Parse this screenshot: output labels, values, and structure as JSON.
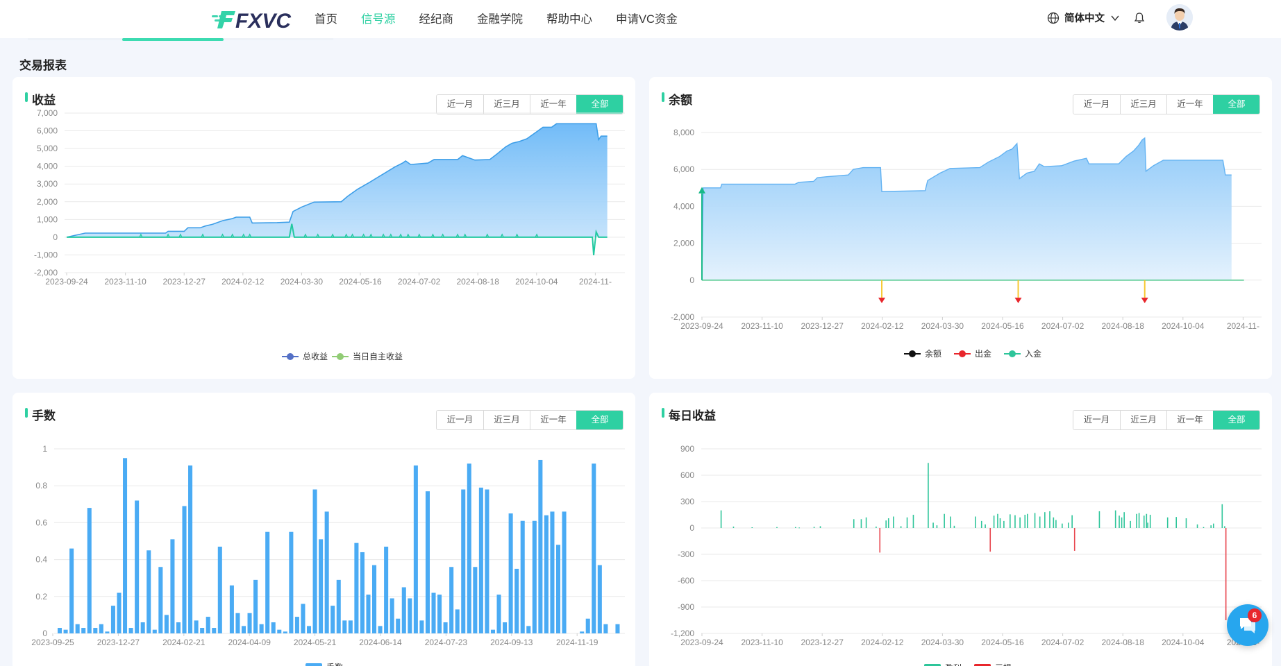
{
  "header": {
    "logo_text": "FXVC",
    "nav": [
      "首页",
      "信号源",
      "经纪商",
      "金融学院",
      "帮助中心",
      "申请VC资金"
    ],
    "language": "简体中文"
  },
  "page": {
    "section_title": "交易报表"
  },
  "range_options": [
    "近一月",
    "近三月",
    "近一年",
    "全部"
  ],
  "colors": {
    "accent": "#2ed0a2",
    "area_blue": "#5ab0f5",
    "bar_blue": "#4aabf4",
    "profit": "#2ec59a",
    "loss": "#e8464e",
    "deposit": "#19b989",
    "withdraw_marker": "#f7c934"
  },
  "chat": {
    "badge": "6"
  },
  "chart_data": [
    {
      "type": "area",
      "title": "收益",
      "x_ticks": [
        "2023-09-24",
        "2023-11-10",
        "2023-12-27",
        "2024-02-12",
        "2024-03-30",
        "2024-05-16",
        "2024-07-02",
        "2024-08-18",
        "2024-10-04",
        "2024-11-"
      ],
      "y_ticks": [
        "7,000",
        "6,000",
        "5,000",
        "4,000",
        "3,000",
        "2,000",
        "1,000",
        "0",
        "-1,000",
        "-2,000"
      ],
      "ylim": [
        -2000,
        7000
      ],
      "x_range_days": [
        0,
        440
      ],
      "grid": true,
      "legend": [
        "总收益",
        "当日自主收益"
      ],
      "legend_colors": [
        "#5470c6",
        "#91cc75"
      ],
      "series": [
        {
          "name": "总收益",
          "points": [
            [
              0,
              0
            ],
            [
              15,
              230
            ],
            [
              80,
              230
            ],
            [
              82,
              330
            ],
            [
              95,
              330
            ],
            [
              98,
              530
            ],
            [
              108,
              530
            ],
            [
              112,
              630
            ],
            [
              118,
              730
            ],
            [
              126,
              930
            ],
            [
              134,
              1050
            ],
            [
              137,
              1130
            ],
            [
              148,
              1130
            ],
            [
              150,
              800
            ],
            [
              170,
              820
            ],
            [
              180,
              850
            ],
            [
              183,
              1450
            ],
            [
              190,
              1700
            ],
            [
              200,
              1980
            ],
            [
              222,
              2000
            ],
            [
              227,
              2300
            ],
            [
              235,
              2700
            ],
            [
              240,
              2900
            ],
            [
              245,
              3100
            ],
            [
              252,
              3400
            ],
            [
              258,
              3650
            ],
            [
              265,
              3950
            ],
            [
              272,
              4200
            ],
            [
              274,
              4300
            ],
            [
              278,
              4100
            ],
            [
              292,
              4180
            ],
            [
              297,
              4380
            ],
            [
              316,
              4380
            ],
            [
              320,
              4600
            ],
            [
              330,
              4350
            ],
            [
              342,
              4380
            ],
            [
              348,
              4700
            ],
            [
              355,
              5100
            ],
            [
              360,
              5300
            ],
            [
              366,
              5400
            ],
            [
              372,
              5550
            ],
            [
              378,
              5850
            ],
            [
              385,
              6200
            ],
            [
              392,
              6200
            ],
            [
              396,
              6400
            ],
            [
              428,
              6400
            ],
            [
              430,
              5500
            ],
            [
              432,
              5700
            ],
            [
              437,
              5700
            ]
          ]
        },
        {
          "name": "当日自主收益",
          "points": [
            [
              0,
              0
            ],
            [
              180,
              0
            ],
            [
              182,
              750
            ],
            [
              184,
              0
            ],
            [
              425,
              0
            ],
            [
              426,
              -1020
            ],
            [
              428,
              300
            ],
            [
              430,
              0
            ],
            [
              437,
              0
            ]
          ],
          "spikes_minor": [
            60,
            82,
            92,
            110,
            126,
            134,
            143,
            148,
            193,
            203,
            215,
            226,
            231,
            240,
            246,
            256,
            262,
            270,
            276,
            285,
            296,
            304,
            316,
            322,
            340,
            352,
            364,
            380
          ]
        }
      ]
    },
    {
      "type": "area",
      "title": "余额",
      "x_ticks": [
        "2023-09-24",
        "2023-11-10",
        "2023-12-27",
        "2024-02-12",
        "2024-03-30",
        "2024-05-16",
        "2024-07-02",
        "2024-08-18",
        "2024-10-04",
        "2024-11-"
      ],
      "y_ticks": [
        "8,000",
        "6,000",
        "4,000",
        "2,000",
        "0",
        "-2,000"
      ],
      "ylim": [
        -2000,
        8000
      ],
      "x_range_days": [
        0,
        440
      ],
      "grid": true,
      "legend": [
        "余额",
        "出金",
        "入金"
      ],
      "legend_colors": [
        "#111111",
        "#e8262c",
        "#2ec59a"
      ],
      "series": [
        {
          "name": "余额",
          "points": [
            [
              0,
              0
            ],
            [
              1,
              5000
            ],
            [
              15,
              5000
            ],
            [
              16,
              5200
            ],
            [
              75,
              5200
            ],
            [
              78,
              5300
            ],
            [
              90,
              5350
            ],
            [
              93,
              5550
            ],
            [
              100,
              5600
            ],
            [
              118,
              5700
            ],
            [
              122,
              6000
            ],
            [
              130,
              6100
            ],
            [
              144,
              6100
            ],
            [
              145,
              4800
            ],
            [
              180,
              4850
            ],
            [
              182,
              5400
            ],
            [
              192,
              5800
            ],
            [
              200,
              6050
            ],
            [
              224,
              6100
            ],
            [
              231,
              6400
            ],
            [
              240,
              6700
            ],
            [
              246,
              7000
            ],
            [
              250,
              7100
            ],
            [
              254,
              7400
            ],
            [
              256,
              5500
            ],
            [
              262,
              5800
            ],
            [
              268,
              5900
            ],
            [
              272,
              6300
            ],
            [
              276,
              6150
            ],
            [
              290,
              6200
            ],
            [
              300,
              6450
            ],
            [
              310,
              6600
            ],
            [
              312,
              6300
            ],
            [
              336,
              6300
            ],
            [
              342,
              6700
            ],
            [
              348,
              7000
            ],
            [
              352,
              7300
            ],
            [
              355,
              7600
            ],
            [
              357,
              7700
            ],
            [
              358,
              5900
            ],
            [
              364,
              6200
            ],
            [
              372,
              6500
            ],
            [
              408,
              6500
            ],
            [
              420,
              6500
            ],
            [
              422,
              5700
            ],
            [
              427,
              5700
            ]
          ]
        },
        {
          "name": "出金",
          "days": [
            145,
            255,
            357
          ],
          "value": -1000
        },
        {
          "name": "入金",
          "days": [
            0
          ],
          "value": 5000
        }
      ]
    },
    {
      "type": "bar",
      "title": "手数",
      "x_ticks": [
        "2023-09-25",
        "2023-12-27",
        "2024-02-21",
        "2024-04-09",
        "2024-05-21",
        "2024-06-14",
        "2024-07-23",
        "2024-09-13",
        "2024-11-19"
      ],
      "y_ticks": [
        "1",
        "0.8",
        "0.6",
        "0.4",
        "0.2",
        "0"
      ],
      "ylim": [
        0,
        1
      ],
      "grid": true,
      "legend": [
        "手数"
      ],
      "values": [
        0.03,
        0.02,
        0.46,
        0.05,
        0.03,
        0.68,
        0.03,
        0.05,
        0.01,
        0.15,
        0.22,
        0.95,
        0.03,
        0.72,
        0.06,
        0.45,
        0.02,
        0.36,
        0.1,
        0.51,
        0.06,
        0.69,
        0.91,
        0.07,
        0.03,
        0.09,
        0.03,
        0.47,
        0,
        0.26,
        0.11,
        0.04,
        0.11,
        0.29,
        0.05,
        0.55,
        0.06,
        0.02,
        0.01,
        0.55,
        0.09,
        0.16,
        0.04,
        0.78,
        0.51,
        0.66,
        0.15,
        0.29,
        0.07,
        0.07,
        0.49,
        0.44,
        0.21,
        0.37,
        0.04,
        0.47,
        0.19,
        0.08,
        0.25,
        0.19,
        0.91,
        0.07,
        0.77,
        0.22,
        0.21,
        0.06,
        0.36,
        0.13,
        0.78,
        0.92,
        0.36,
        0.79,
        0.78,
        0.02,
        0.21,
        0.06,
        0.65,
        0.35,
        0.61,
        0.04,
        0.61,
        0.94,
        0.64,
        0.66,
        0.48,
        0.66,
        0,
        0,
        0.01,
        0.08,
        0.92,
        0.37,
        0.05,
        0,
        0.05
      ]
    },
    {
      "type": "bar",
      "title": "每日收益",
      "x_ticks": [
        "2023-09-24",
        "2023-11-10",
        "2023-12-27",
        "2024-02-12",
        "2024-03-30",
        "2024-05-16",
        "2024-07-02",
        "2024-08-18",
        "2024-10-04",
        "2024-11-"
      ],
      "y_ticks": [
        "900",
        "600",
        "300",
        "0",
        "-300",
        "-600",
        "-900",
        "-1,200"
      ],
      "ylim": [
        -1200,
        900
      ],
      "x_range_days": [
        0,
        440
      ],
      "grid": true,
      "legend": [
        "盈利",
        "亏损"
      ],
      "legend_colors": [
        "#2ec59a",
        "#e8262c"
      ],
      "values": [
        [
          15,
          200
        ],
        [
          25,
          15
        ],
        [
          40,
          8
        ],
        [
          60,
          10
        ],
        [
          75,
          10
        ],
        [
          78,
          5
        ],
        [
          90,
          12
        ],
        [
          95,
          20
        ],
        [
          122,
          100
        ],
        [
          128,
          100
        ],
        [
          132,
          120
        ],
        [
          140,
          15
        ],
        [
          148,
          85
        ],
        [
          150,
          110
        ],
        [
          154,
          130
        ],
        [
          160,
          20
        ],
        [
          165,
          120
        ],
        [
          170,
          150
        ],
        [
          165,
          12
        ],
        [
          170,
          10
        ],
        [
          182,
          740
        ],
        [
          186,
          60
        ],
        [
          189,
          30
        ],
        [
          195,
          160
        ],
        [
          200,
          130
        ],
        [
          203,
          25
        ],
        [
          220,
          130
        ],
        [
          225,
          80
        ],
        [
          228,
          40
        ],
        [
          235,
          140
        ],
        [
          238,
          160
        ],
        [
          240,
          110
        ],
        [
          243,
          80
        ],
        [
          248,
          155
        ],
        [
          252,
          145
        ],
        [
          256,
          120
        ],
        [
          260,
          150
        ],
        [
          262,
          160
        ],
        [
          268,
          170
        ],
        [
          272,
          130
        ],
        [
          276,
          180
        ],
        [
          280,
          190
        ],
        [
          283,
          120
        ],
        [
          285,
          90
        ],
        [
          290,
          50
        ],
        [
          295,
          60
        ],
        [
          298,
          145
        ],
        [
          320,
          190
        ],
        [
          333,
          200
        ],
        [
          336,
          140
        ],
        [
          338,
          120
        ],
        [
          340,
          180
        ],
        [
          345,
          80
        ],
        [
          350,
          160
        ],
        [
          352,
          170
        ],
        [
          356,
          140
        ],
        [
          358,
          160
        ],
        [
          359,
          60
        ],
        [
          361,
          150
        ],
        [
          375,
          120
        ],
        [
          382,
          125
        ],
        [
          390,
          110
        ],
        [
          399,
          40
        ],
        [
          404,
          10
        ],
        [
          410,
          30
        ],
        [
          412,
          50
        ],
        [
          419,
          270
        ],
        [
          421,
          20
        ],
        [
          143,
          -280
        ],
        [
          232,
          -270
        ],
        [
          300,
          -260
        ],
        [
          422,
          -1050
        ]
      ]
    }
  ]
}
